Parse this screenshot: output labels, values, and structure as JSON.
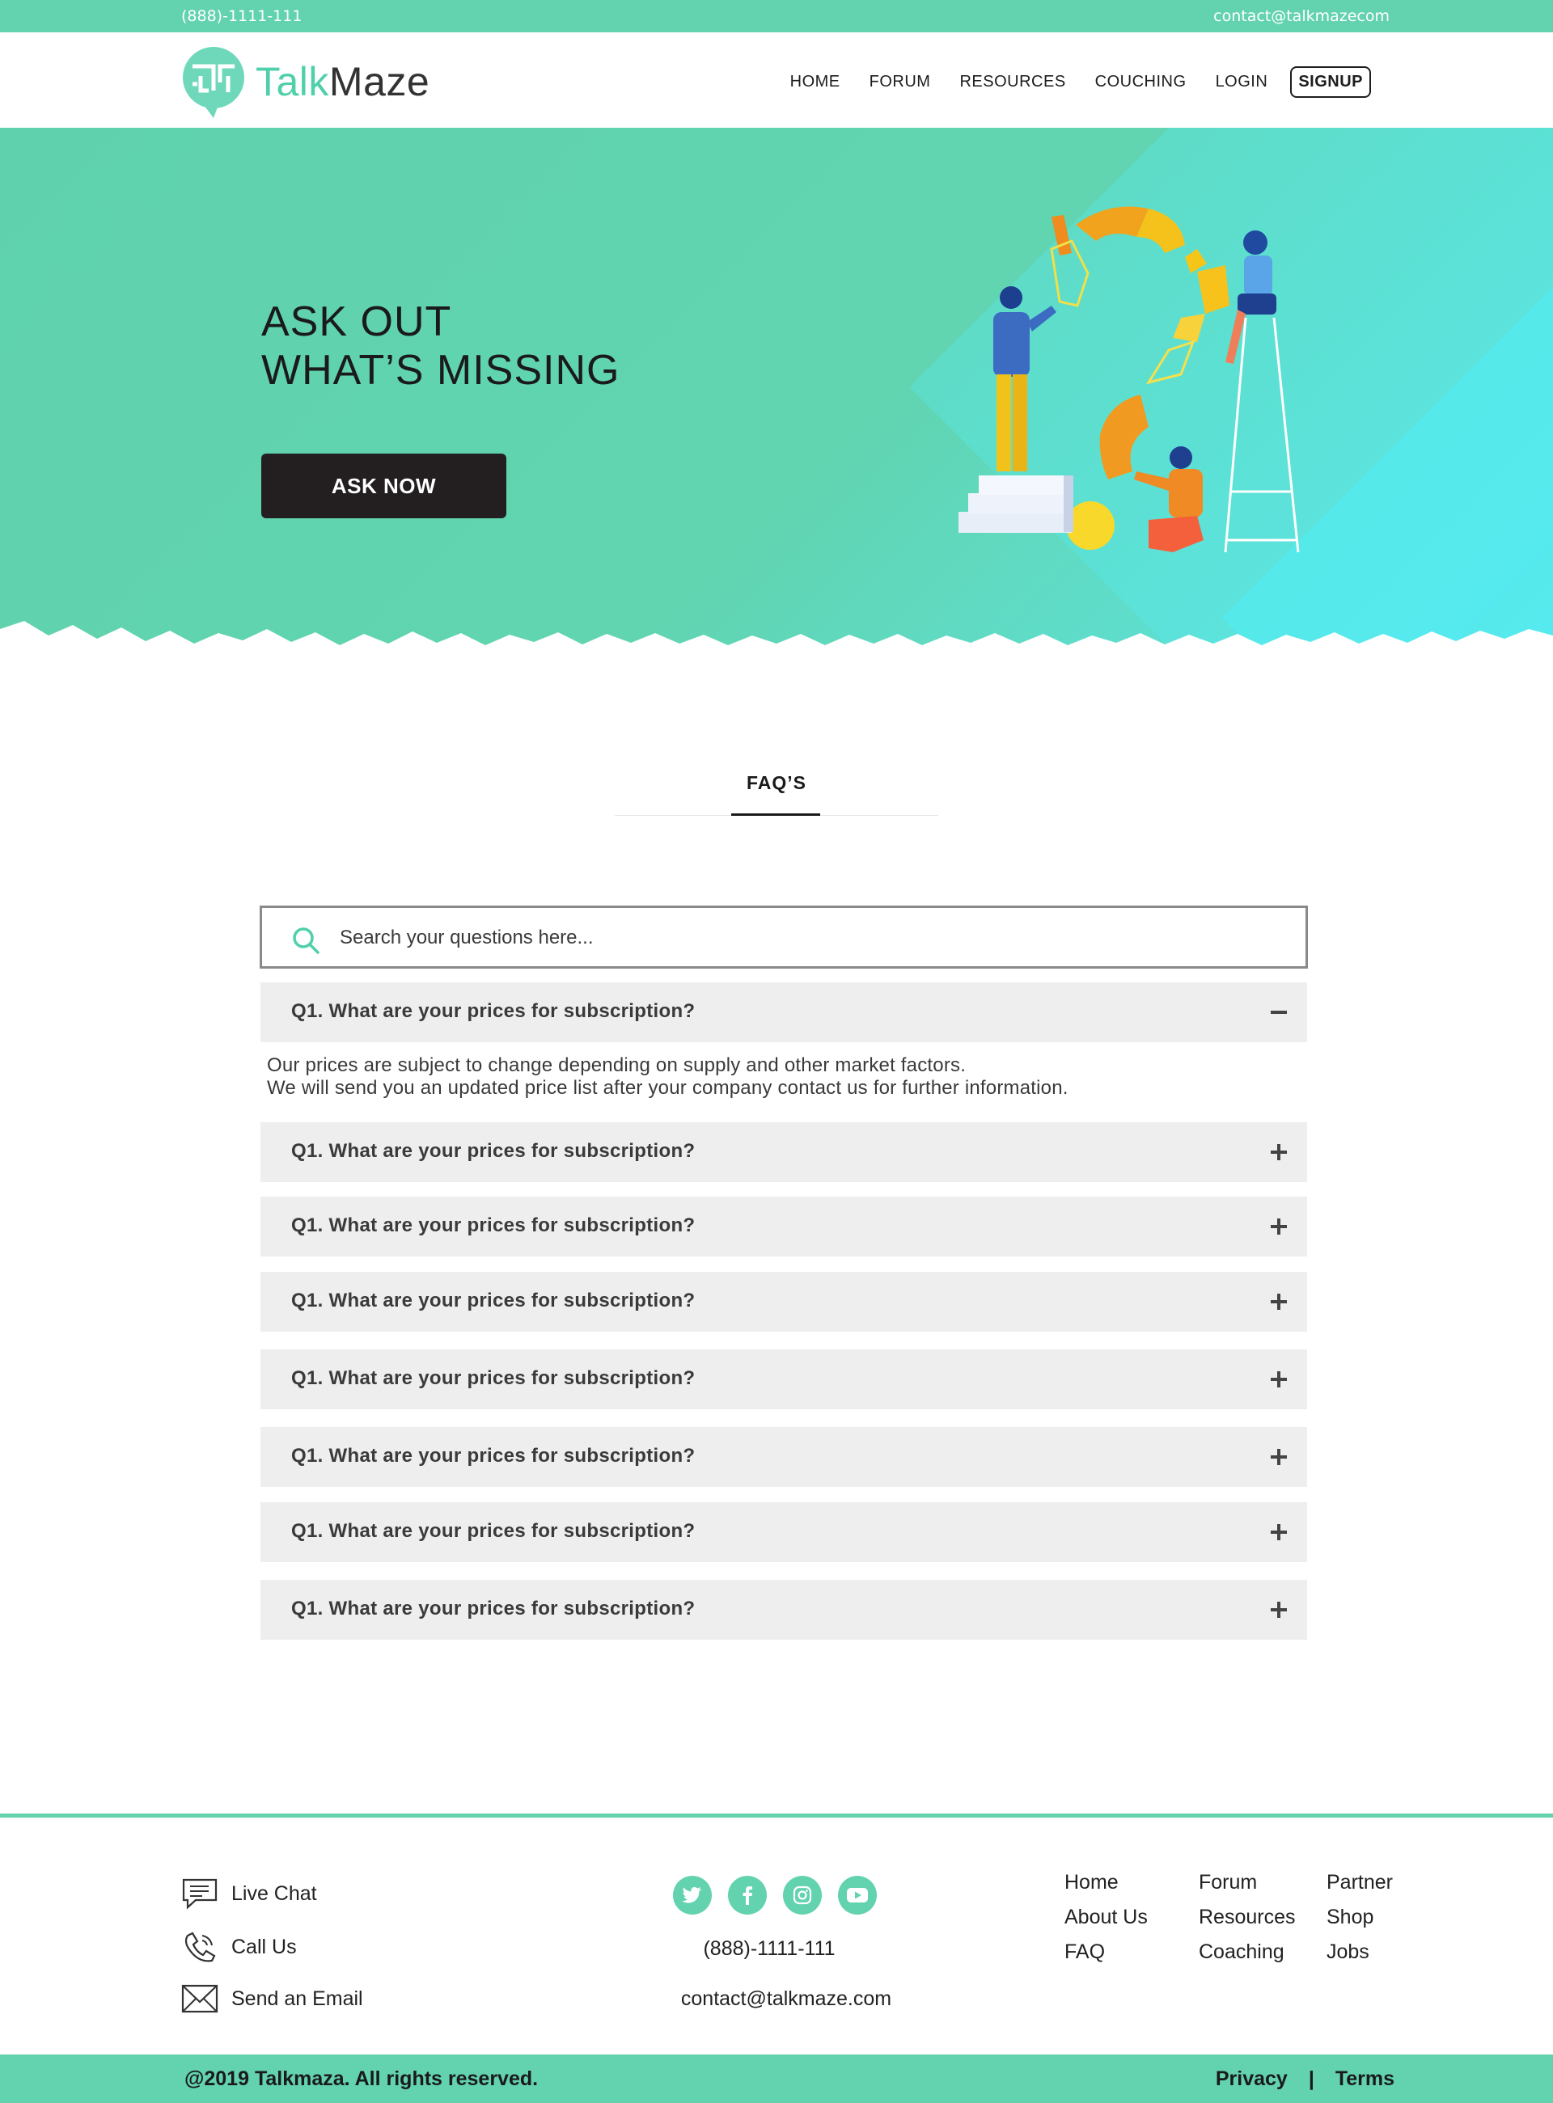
{
  "topbar": {
    "phone": "(888)-1111-111",
    "email": "contact@talkmazecom"
  },
  "header": {
    "logo_talk": "Talk",
    "logo_maze": "Maze",
    "nav": [
      "HOME",
      "FORUM",
      "RESOURCES",
      "COUCHING",
      "LOGIN",
      "SIGNUP"
    ]
  },
  "hero": {
    "title_line1": "ASK OUT",
    "title_line2": "WHAT’S MISSING",
    "button": "ASK NOW"
  },
  "faq": {
    "tab": "FAQ’S",
    "search_placeholder": "Search your questions here...",
    "items": [
      {
        "question": "Q1. What are your prices for subscription?",
        "expanded": true
      },
      {
        "question": "Q1. What are your prices for subscription?",
        "expanded": false
      },
      {
        "question": "Q1. What are your prices for subscription?",
        "expanded": false
      },
      {
        "question": "Q1. What are your prices for subscription?",
        "expanded": false
      },
      {
        "question": "Q1. What are your prices for subscription?",
        "expanded": false
      },
      {
        "question": "Q1. What are your prices for subscription?",
        "expanded": false
      },
      {
        "question": "Q1. What are your prices for subscription?",
        "expanded": false
      },
      {
        "question": "Q1. What are your prices for subscription?",
        "expanded": false
      }
    ],
    "answer_line1": "Our prices are subject to change depending on supply and other market factors.",
    "answer_line2": "We will send you an updated price list after your company contact us for further information."
  },
  "footer": {
    "contacts": [
      "Live Chat",
      "Call Us",
      "Send an Email"
    ],
    "socials": [
      "twitter-icon",
      "facebook-icon",
      "instagram-icon",
      "youtube-icon"
    ],
    "phone": "(888)-1111-111",
    "email": "contact@talkmaze.com",
    "links": {
      "col1": [
        "Home",
        "About Us",
        "FAQ"
      ],
      "col2": [
        "Forum",
        "Resources",
        "Coaching"
      ],
      "col3": [
        "Partner",
        "Shop",
        "Jobs"
      ]
    },
    "copyright": "@2019 Talkmaza. All rights reserved.",
    "privacy": "Privacy",
    "separator": "|",
    "terms": "Terms"
  },
  "colors": {
    "accent": "#62d2af",
    "dark_button": "#231f20",
    "faq_bg": "#eeeeee"
  }
}
